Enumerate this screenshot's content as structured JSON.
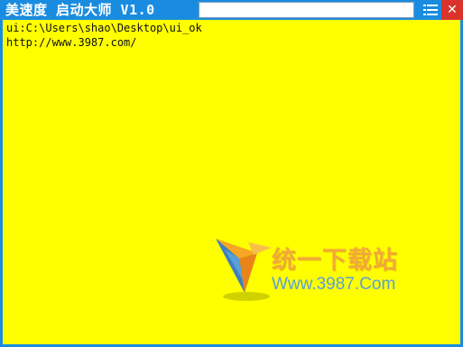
{
  "window": {
    "title": "美速度 启动大师 V1.0",
    "search_value": "",
    "colors": {
      "titlebar": "#1A8CE0",
      "background": "#FFFF00",
      "close": "#D9342B"
    }
  },
  "titlebar_icons": {
    "menu": "list-icon",
    "close": "close-icon",
    "close_glyph": "✕"
  },
  "content": {
    "lines": [
      "ui:C:\\Users\\shao\\Desktop\\ui_ok",
      "http://www.3987.com/"
    ]
  },
  "watermark": {
    "brand_cn": "统一下载站",
    "brand_url": "Www.3987.Com"
  }
}
